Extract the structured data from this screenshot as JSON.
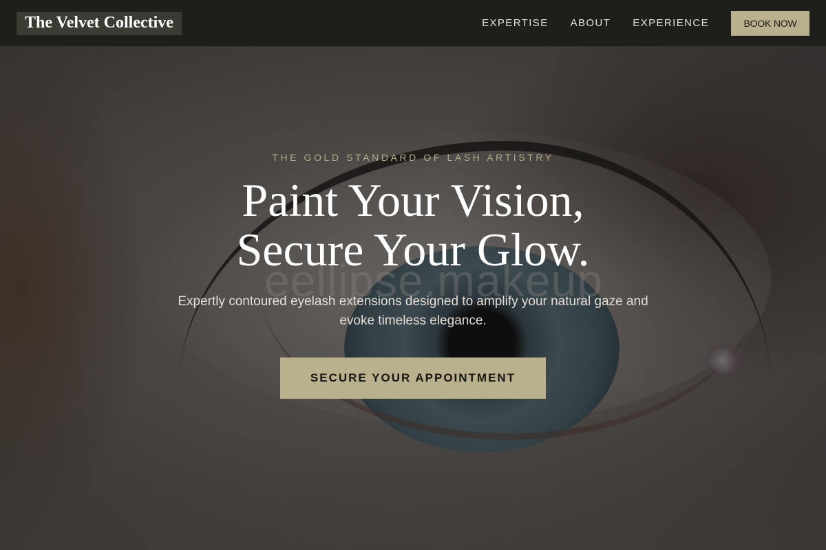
{
  "brand": {
    "name": "The Velvet Collective"
  },
  "nav": {
    "links": [
      "EXPERTISE",
      "ABOUT",
      "EXPERIENCE"
    ],
    "cta_label": "BOOK NOW"
  },
  "hero": {
    "eyebrow": "THE GOLD STANDARD OF LASH ARTISTRY",
    "headline_line1": "Paint Your Vision,",
    "headline_line2": "Secure Your Glow.",
    "subtext": "Expertly contoured eyelash extensions designed to amplify your natural gaze and evoke timeless elegance.",
    "cta_label": "SECURE YOUR APPOINTMENT",
    "watermark": "eellipse.makeup"
  },
  "colors": {
    "accent": "#b9b18e",
    "navbar_bg": "#1e1e1a",
    "eyebrow_text": "#b4ab8d"
  },
  "icons": {
    "hero_image": "eye-closeup-photo"
  }
}
